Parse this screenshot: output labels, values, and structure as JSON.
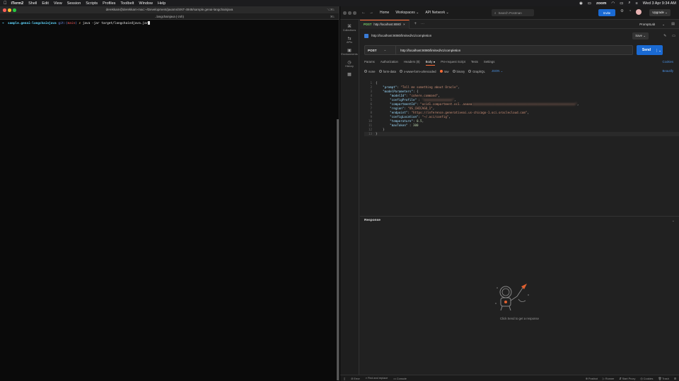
{
  "menubar": {
    "apple": "",
    "app": "iTerm2",
    "items": [
      "Shell",
      "Edit",
      "View",
      "Session",
      "Scripts",
      "Profiles",
      "Toolbelt",
      "Window",
      "Help"
    ],
    "zoom": "zoom",
    "datetime": "Wed 3 Apr 9:34 AM"
  },
  "terminal": {
    "title": "derekkam@derekkam-mac:~/Development/javams/SNT-4948/sample.genai-langchainjava",
    "shortcut_title": "⌥⌘1",
    "tab": "..langchainjava (-zsh)",
    "tab_shortcut": "⌘1",
    "prompt_arrow": "➜",
    "dir": "sample.genai-langchainjava",
    "git": "git:(",
    "branch": "main",
    "git_close": ")",
    "dollar": "✗",
    "command": "java -jar target/langchain4java.jar"
  },
  "postman": {
    "top": {
      "home": "Home",
      "workspaces": "Workspaces ⌄",
      "api_network": "API Network ⌄",
      "search_placeholder": "Search Postman",
      "invite": "Invite",
      "upgrade": "Upgrade ⌄"
    },
    "sidebar": [
      {
        "icon": "⌘",
        "label": "Collections"
      },
      {
        "icon": "⇆",
        "label": "APIs"
      },
      {
        "icon": "▣",
        "label": "Environments"
      },
      {
        "icon": "◷",
        "label": "History"
      },
      {
        "icon": "▦",
        "label": ""
      }
    ],
    "tab": {
      "method": "POST",
      "label": "http://localhost:8080/"
    },
    "env": {
      "name": "PromptLab",
      "chevron": "⌄"
    },
    "request": {
      "title": "http://localhost:8080/limited/v1/completion",
      "save": "Save ⌄",
      "method": "POST",
      "url": "http://localhost:8080/limited/v1/completion",
      "send": "Send",
      "cookies": "Cookies",
      "subtabs": [
        "Params",
        "Authorization",
        "Headers (8)",
        "Body ●",
        "Pre-request Script",
        "Tests",
        "Settings"
      ],
      "body_types": [
        "none",
        "form-data",
        "x-www-form-urlencoded",
        "raw",
        "binary",
        "GraphQL"
      ],
      "body_format": "JSON ⌄",
      "beautify": "Beautify"
    },
    "editor_lines": [
      "1",
      "2",
      "3",
      "4",
      "5",
      "6",
      "7",
      "8",
      "9",
      "10",
      "11",
      "12",
      "13"
    ],
    "code": {
      "l1": "{",
      "prompt_k": "\"prompt\"",
      "prompt_v": "\"Tell me something about Oracle\"",
      "mp_k": "\"modelParameters\"",
      "modelId_k": "\"modelId\"",
      "modelId_v": "\"cohere.command\"",
      "cfgProfile_k": "\"configProfile\"",
      "cfgProfile_v": "\"xxxxxxxxxxxxxxxx\"",
      "compartment_k": "\"compartmentId\"",
      "compartment_v": "\"ocid1.compartment.oc1..aaaaa",
      "compartment_blur": "xxxxxxxxxxxxxxxxxxxxxxxxxxxxxxxxxxxxxxxxxxxxxxxxxxxxxxxxxx\"",
      "region_k": "\"region\"",
      "region_v": "\"US_CHICAGO_1\"",
      "endpoint_k": "\"endpoint\"",
      "endpoint_v": "\"https://inference.generativeai.us-chicago-1.oci.oraclecloud.com\"",
      "cfgLoc_k": "\"configLocation\"",
      "cfgLoc_v": "\"~/.oci/config\"",
      "temp_k": "\"temperature\"",
      "temp_v": "0.5",
      "max_k": "\"maxToken\"",
      "max_v": "300",
      "l12": "    }",
      "l13": "}"
    },
    "response": {
      "title": "Response",
      "hint": "Click Send to get a response"
    },
    "statusbar": {
      "left": [
        "⊘ Error",
        "⌕ Find and replace",
        "▭ Console"
      ],
      "right": [
        "⊕ Postbot",
        "▷ Runner",
        "⇵ Start Proxy",
        "◎ Cookies",
        "🗑 Trash",
        "⊞"
      ]
    },
    "colors": {
      "accent": "#ff6c37",
      "send": "#1a6ad3"
    }
  }
}
